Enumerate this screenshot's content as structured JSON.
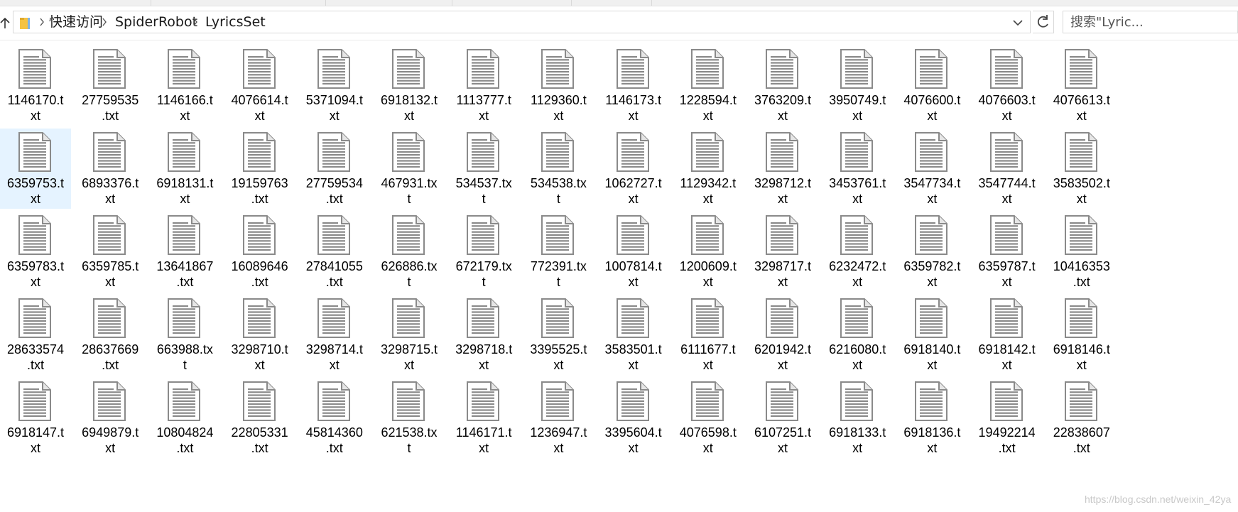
{
  "address": {
    "breadcrumbs": [
      "快速访问",
      "SpiderRobot",
      "LyricsSet"
    ]
  },
  "search": {
    "placeholder": "搜索\"Lyric...",
    "value": ""
  },
  "files": [
    {
      "n1": "1146170.t",
      "n2": "xt"
    },
    {
      "n1": "27759535",
      "n2": ".txt"
    },
    {
      "n1": "1146166.t",
      "n2": "xt"
    },
    {
      "n1": "4076614.t",
      "n2": "xt"
    },
    {
      "n1": "5371094.t",
      "n2": "xt"
    },
    {
      "n1": "6918132.t",
      "n2": "xt"
    },
    {
      "n1": "1113777.t",
      "n2": "xt"
    },
    {
      "n1": "1129360.t",
      "n2": "xt"
    },
    {
      "n1": "1146173.t",
      "n2": "xt"
    },
    {
      "n1": "1228594.t",
      "n2": "xt"
    },
    {
      "n1": "3763209.t",
      "n2": "xt"
    },
    {
      "n1": "3950749.t",
      "n2": "xt"
    },
    {
      "n1": "4076600.t",
      "n2": "xt"
    },
    {
      "n1": "4076603.t",
      "n2": "xt"
    },
    {
      "n1": "4076613.t",
      "n2": "xt"
    },
    {
      "n1": "6359753.t",
      "n2": "xt",
      "selected": true
    },
    {
      "n1": "6893376.t",
      "n2": "xt"
    },
    {
      "n1": "6918131.t",
      "n2": "xt"
    },
    {
      "n1": "19159763",
      "n2": ".txt"
    },
    {
      "n1": "27759534",
      "n2": ".txt"
    },
    {
      "n1": "467931.tx",
      "n2": "t"
    },
    {
      "n1": "534537.tx",
      "n2": "t"
    },
    {
      "n1": "534538.tx",
      "n2": "t"
    },
    {
      "n1": "1062727.t",
      "n2": "xt"
    },
    {
      "n1": "1129342.t",
      "n2": "xt"
    },
    {
      "n1": "3298712.t",
      "n2": "xt"
    },
    {
      "n1": "3453761.t",
      "n2": "xt"
    },
    {
      "n1": "3547734.t",
      "n2": "xt"
    },
    {
      "n1": "3547744.t",
      "n2": "xt"
    },
    {
      "n1": "3583502.t",
      "n2": "xt"
    },
    {
      "n1": "6359783.t",
      "n2": "xt"
    },
    {
      "n1": "6359785.t",
      "n2": "xt"
    },
    {
      "n1": "13641867",
      "n2": ".txt"
    },
    {
      "n1": "16089646",
      "n2": ".txt"
    },
    {
      "n1": "27841055",
      "n2": ".txt"
    },
    {
      "n1": "626886.tx",
      "n2": "t"
    },
    {
      "n1": "672179.tx",
      "n2": "t"
    },
    {
      "n1": "772391.tx",
      "n2": "t"
    },
    {
      "n1": "1007814.t",
      "n2": "xt"
    },
    {
      "n1": "1200609.t",
      "n2": "xt"
    },
    {
      "n1": "3298717.t",
      "n2": "xt"
    },
    {
      "n1": "6232472.t",
      "n2": "xt"
    },
    {
      "n1": "6359782.t",
      "n2": "xt"
    },
    {
      "n1": "6359787.t",
      "n2": "xt"
    },
    {
      "n1": "10416353",
      "n2": ".txt"
    },
    {
      "n1": "28633574",
      "n2": ".txt"
    },
    {
      "n1": "28637669",
      "n2": ".txt"
    },
    {
      "n1": "663988.tx",
      "n2": "t"
    },
    {
      "n1": "3298710.t",
      "n2": "xt"
    },
    {
      "n1": "3298714.t",
      "n2": "xt"
    },
    {
      "n1": "3298715.t",
      "n2": "xt"
    },
    {
      "n1": "3298718.t",
      "n2": "xt"
    },
    {
      "n1": "3395525.t",
      "n2": "xt"
    },
    {
      "n1": "3583501.t",
      "n2": "xt"
    },
    {
      "n1": "6111677.t",
      "n2": "xt"
    },
    {
      "n1": "6201942.t",
      "n2": "xt"
    },
    {
      "n1": "6216080.t",
      "n2": "xt"
    },
    {
      "n1": "6918140.t",
      "n2": "xt"
    },
    {
      "n1": "6918142.t",
      "n2": "xt"
    },
    {
      "n1": "6918146.t",
      "n2": "xt"
    },
    {
      "n1": "6918147.t",
      "n2": "xt"
    },
    {
      "n1": "6949879.t",
      "n2": "xt"
    },
    {
      "n1": "10804824",
      "n2": ".txt"
    },
    {
      "n1": "22805331",
      "n2": ".txt"
    },
    {
      "n1": "45814360",
      "n2": ".txt"
    },
    {
      "n1": "621538.tx",
      "n2": "t"
    },
    {
      "n1": "1146171.t",
      "n2": "xt"
    },
    {
      "n1": "1236947.t",
      "n2": "xt"
    },
    {
      "n1": "3395604.t",
      "n2": "xt"
    },
    {
      "n1": "4076598.t",
      "n2": "xt"
    },
    {
      "n1": "6107251.t",
      "n2": "xt"
    },
    {
      "n1": "6918133.t",
      "n2": "xt"
    },
    {
      "n1": "6918136.t",
      "n2": "xt"
    },
    {
      "n1": "19492214",
      "n2": ".txt"
    },
    {
      "n1": "22838607",
      "n2": ".txt"
    }
  ],
  "watermark": "https://blog.csdn.net/weixin_42ya",
  "icons": {
    "up": "up-arrow-icon",
    "folder": "folder-icon",
    "separator": "chevron-right-icon",
    "dropdown": "chevron-down-icon",
    "refresh": "refresh-icon",
    "file": "text-file-icon"
  },
  "colors": {
    "selection": "#e5f3ff",
    "folder": "#f5c342",
    "icon_gray": "#8a8a8a"
  }
}
